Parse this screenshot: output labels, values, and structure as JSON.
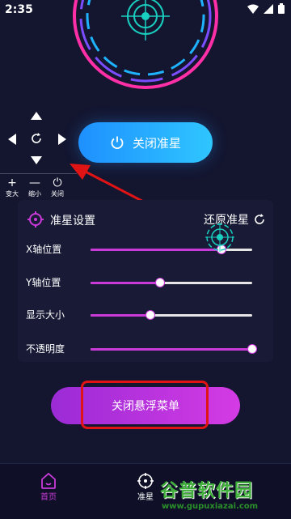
{
  "status_bar": {
    "time": "2:35"
  },
  "dpad": {
    "tools": [
      {
        "glyph": "+",
        "label": "变大"
      },
      {
        "glyph": "—",
        "label": "缩小"
      },
      {
        "glyph": "⏻",
        "label": "关闭"
      }
    ]
  },
  "main_button": {
    "label": "关闭准星",
    "icon": "power-icon"
  },
  "panel": {
    "title": "准星设置",
    "reset_label": "还原准星",
    "sliders": [
      {
        "label": "X轴位置",
        "value": 0.81
      },
      {
        "label": "Y轴位置",
        "value": 0.43
      },
      {
        "label": "显示大小",
        "value": 0.37
      },
      {
        "label": "不透明度",
        "value": 1.0
      }
    ]
  },
  "menu_button": {
    "label": "关闭悬浮菜单"
  },
  "bottom_nav": {
    "items": [
      {
        "label": "首页"
      },
      {
        "label": "准星"
      }
    ]
  },
  "watermark": {
    "text": "谷普软件园",
    "url": "www.gupuxiazai.com"
  },
  "colors": {
    "accent_purple": "#c93ad8",
    "accent_blue": "#1e90ff",
    "annotation_red": "#e01414",
    "background": "#141630"
  }
}
